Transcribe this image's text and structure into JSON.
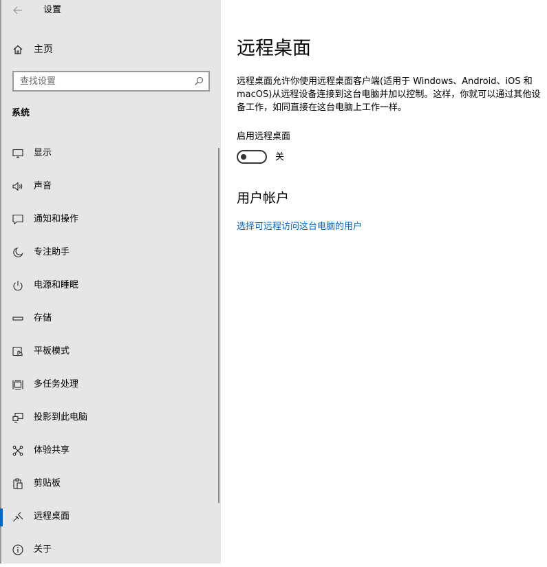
{
  "window": {
    "title": "设置"
  },
  "sidebar": {
    "home_label": "主页",
    "search": {
      "placeholder": "查找设置",
      "value": ""
    },
    "section_label": "系统",
    "items": [
      {
        "label": "显示",
        "icon": "display-icon"
      },
      {
        "label": "声音",
        "icon": "speaker-icon"
      },
      {
        "label": "通知和操作",
        "icon": "notification-icon"
      },
      {
        "label": "专注助手",
        "icon": "moon-icon"
      },
      {
        "label": "电源和睡眠",
        "icon": "power-icon"
      },
      {
        "label": "存储",
        "icon": "storage-icon"
      },
      {
        "label": "平板模式",
        "icon": "tablet-mode-icon"
      },
      {
        "label": "多任务处理",
        "icon": "multitasking-icon"
      },
      {
        "label": "投影到此电脑",
        "icon": "project-icon"
      },
      {
        "label": "体验共享",
        "icon": "shared-experiences-icon"
      },
      {
        "label": "剪贴板",
        "icon": "clipboard-icon"
      },
      {
        "label": "远程桌面",
        "icon": "remote-desktop-icon",
        "selected": true
      },
      {
        "label": "关于",
        "icon": "info-icon"
      }
    ]
  },
  "main": {
    "title": "远程桌面",
    "description": "远程桌面允许你使用远程桌面客户端(适用于 Windows、Android、iOS 和 macOS)从远程设备连接到这台电脑并加以控制。这样，你就可以通过其他设备工作，如同直接在这台电脑上工作一样。",
    "toggle": {
      "label": "启用远程桌面",
      "state": "关",
      "on": false
    },
    "user_accounts": {
      "title": "用户帐户",
      "link": "选择可远程访问这台电脑的用户"
    }
  },
  "colors": {
    "accent": "#0067c0",
    "sidebar_bg": "#e6e6e6",
    "content_bg": "#ffffff"
  }
}
